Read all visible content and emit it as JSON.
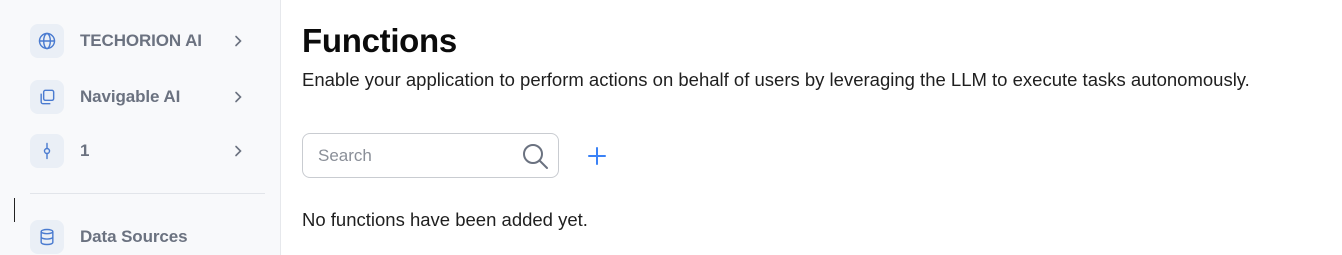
{
  "sidebar": {
    "items": [
      {
        "label": "TECHORION AI",
        "icon": "globe-icon"
      },
      {
        "label": "Navigable AI",
        "icon": "copy-icon"
      },
      {
        "label": "1",
        "icon": "commit-icon"
      },
      {
        "label": "Data Sources",
        "icon": "database-icon"
      }
    ]
  },
  "main": {
    "title": "Functions",
    "description": "Enable your application to perform actions on behalf of users by leveraging the LLM to execute tasks autonomously.",
    "search": {
      "placeholder": "Search",
      "value": ""
    },
    "empty_message": "No functions have been added yet."
  },
  "colors": {
    "accent": "#3b82f6",
    "icon_stroke": "#4a7bd0",
    "icon_bg": "#eaeff6",
    "sidebar_bg": "#f8f9fb"
  }
}
